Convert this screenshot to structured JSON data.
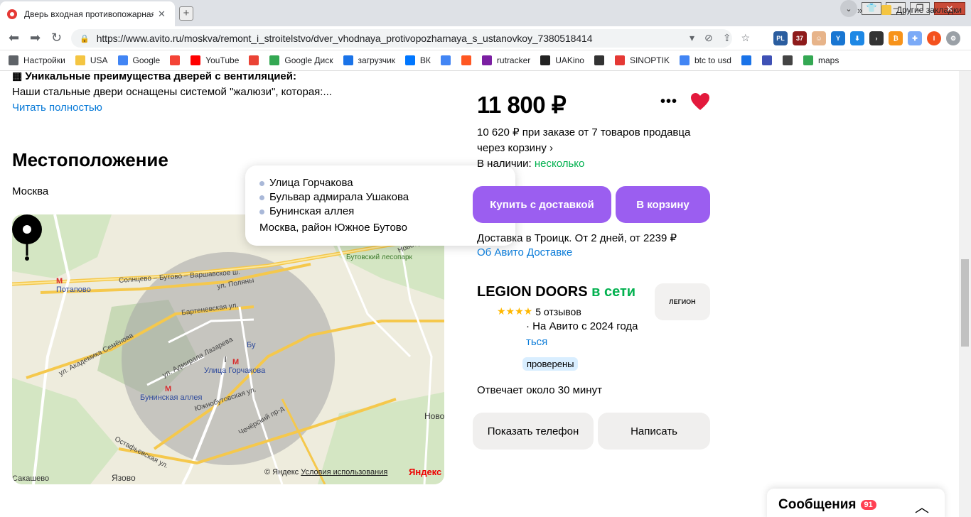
{
  "browser": {
    "tab_title": "Дверь входная противопожарная",
    "tab_close": "✕",
    "new_tab": "+",
    "url": "https://www.avito.ru/moskva/remont_i_stroitelstvo/dver_vhodnaya_protivopozharnaya_s_ustanovkoy_7380518414",
    "bookmarks": [
      {
        "label": "Настройки",
        "icon": "gear-icon",
        "color": "#5f6368"
      },
      {
        "label": "USA",
        "icon": "folder-icon",
        "color": "#f4c542"
      },
      {
        "label": "Google",
        "icon": "google-icon",
        "color": "#4285f4"
      },
      {
        "label": "",
        "icon": "yandex-icon",
        "color": "#f44336"
      },
      {
        "label": "YouTube",
        "icon": "youtube-icon",
        "color": "#ff0000"
      },
      {
        "label": "",
        "icon": "gmail-icon",
        "color": "#ea4335"
      },
      {
        "label": "Google Диск",
        "icon": "drive-icon",
        "color": "#34a853"
      },
      {
        "label": "загрузчик",
        "icon": "infinity-icon",
        "color": "#1a73e8"
      },
      {
        "label": "ВК",
        "icon": "vk-icon",
        "color": "#0077ff"
      },
      {
        "label": "",
        "icon": "translate-icon",
        "color": "#4285f4"
      },
      {
        "label": "",
        "icon": "f-icon",
        "color": "#ff5722"
      },
      {
        "label": "rutracker",
        "icon": "rutracker-icon",
        "color": "#7b1fa2"
      },
      {
        "label": "UAKino",
        "icon": "uakino-icon",
        "color": "#222222"
      },
      {
        "label": "",
        "icon": "figure-icon",
        "color": "#333333"
      },
      {
        "label": "SINOPTIK",
        "icon": "thermometer-icon",
        "color": "#e53935"
      },
      {
        "label": "btc to usd",
        "icon": "google-icon",
        "color": "#4285f4"
      },
      {
        "label": "",
        "icon": "p-icon",
        "color": "#1a73e8"
      },
      {
        "label": "",
        "icon": "arrow-icon",
        "color": "#3f51b5"
      },
      {
        "label": "",
        "icon": "bc-icon",
        "color": "#444444"
      },
      {
        "label": "maps",
        "icon": "maps-icon",
        "color": "#34a853"
      }
    ],
    "bookmarks_more": "»",
    "other_bookmarks": "Другие закладки"
  },
  "listing": {
    "advantages_title": "Уникальные преимущества дверей с вентиляцией:",
    "advantages_text": "Наши стальные двери оснащены системой \"жалюзи\", которая:...",
    "read_more": "Читать полностью",
    "location_title": "Местоположение",
    "city": "Москва"
  },
  "map": {
    "labels": {
      "potapovo": "Потаповo",
      "butovsky_park": "Бутовский лесопарк",
      "novobutovskaya": "Новобутовская ул.",
      "solntsevo": "Солнцево – Бутово – Варшавское ш.",
      "poliany": "ул. Поляны",
      "bartenevskaya": "Бартеневская ул.",
      "akademika": "ул. Академика Семёнова",
      "admirala": "ул. Адмирала Лазарева",
      "yuzhnobutovskaya": "Южнобутовская ул.",
      "chechersky": "Чечёрский пр-д",
      "ostafyevskaya": "Остафьевская ул.",
      "yazovo": "Язово",
      "sakashevo": "Сакашево",
      "novo": "Ново",
      "bu": "Бу"
    },
    "metro_gorchakova": "Улица Горчакова",
    "metro_bunin": "Бунинская аллея",
    "metro_symbol": "М",
    "popup_items": [
      "Улица Горчакова",
      "Бульвар адмирала Ушакова",
      "Бунинская аллея"
    ],
    "popup_address": "Москва, район Южное Бутово",
    "copyright": "© Яндекс",
    "terms": "Условия использования",
    "yandex_logo": "Яндекс"
  },
  "product": {
    "price": "11 800 ₽",
    "more": "•••",
    "bulk_price": "10 620 ₽ при заказе от 7 товаров продавца через корзину ›",
    "availability_label": "В наличии:",
    "availability_value": "несколько",
    "buy_delivery": "Купить с доставкой",
    "to_cart": "В корзину",
    "delivery_info": "Доставка в Троицк. От 2 дней, от 2239 ₽",
    "delivery_link": "Об Авито Доставке",
    "favorite_color": "#e3193c",
    "accent": "#9b5ef0"
  },
  "seller": {
    "name": "LEGION DOORS",
    "online": "в сети",
    "reviews": "5 отзывов",
    "since": "· На Авито с 2024 года",
    "subscribe_partial": "ться",
    "verified_partial": "проверены",
    "reply_time": "Отвечает около 30 минут",
    "logo_text": "ЛЕГИОН"
  },
  "actions": {
    "show_phone": "Показать телефон",
    "write": "Написать"
  },
  "messages": {
    "title": "Сообщения",
    "count": "91"
  }
}
